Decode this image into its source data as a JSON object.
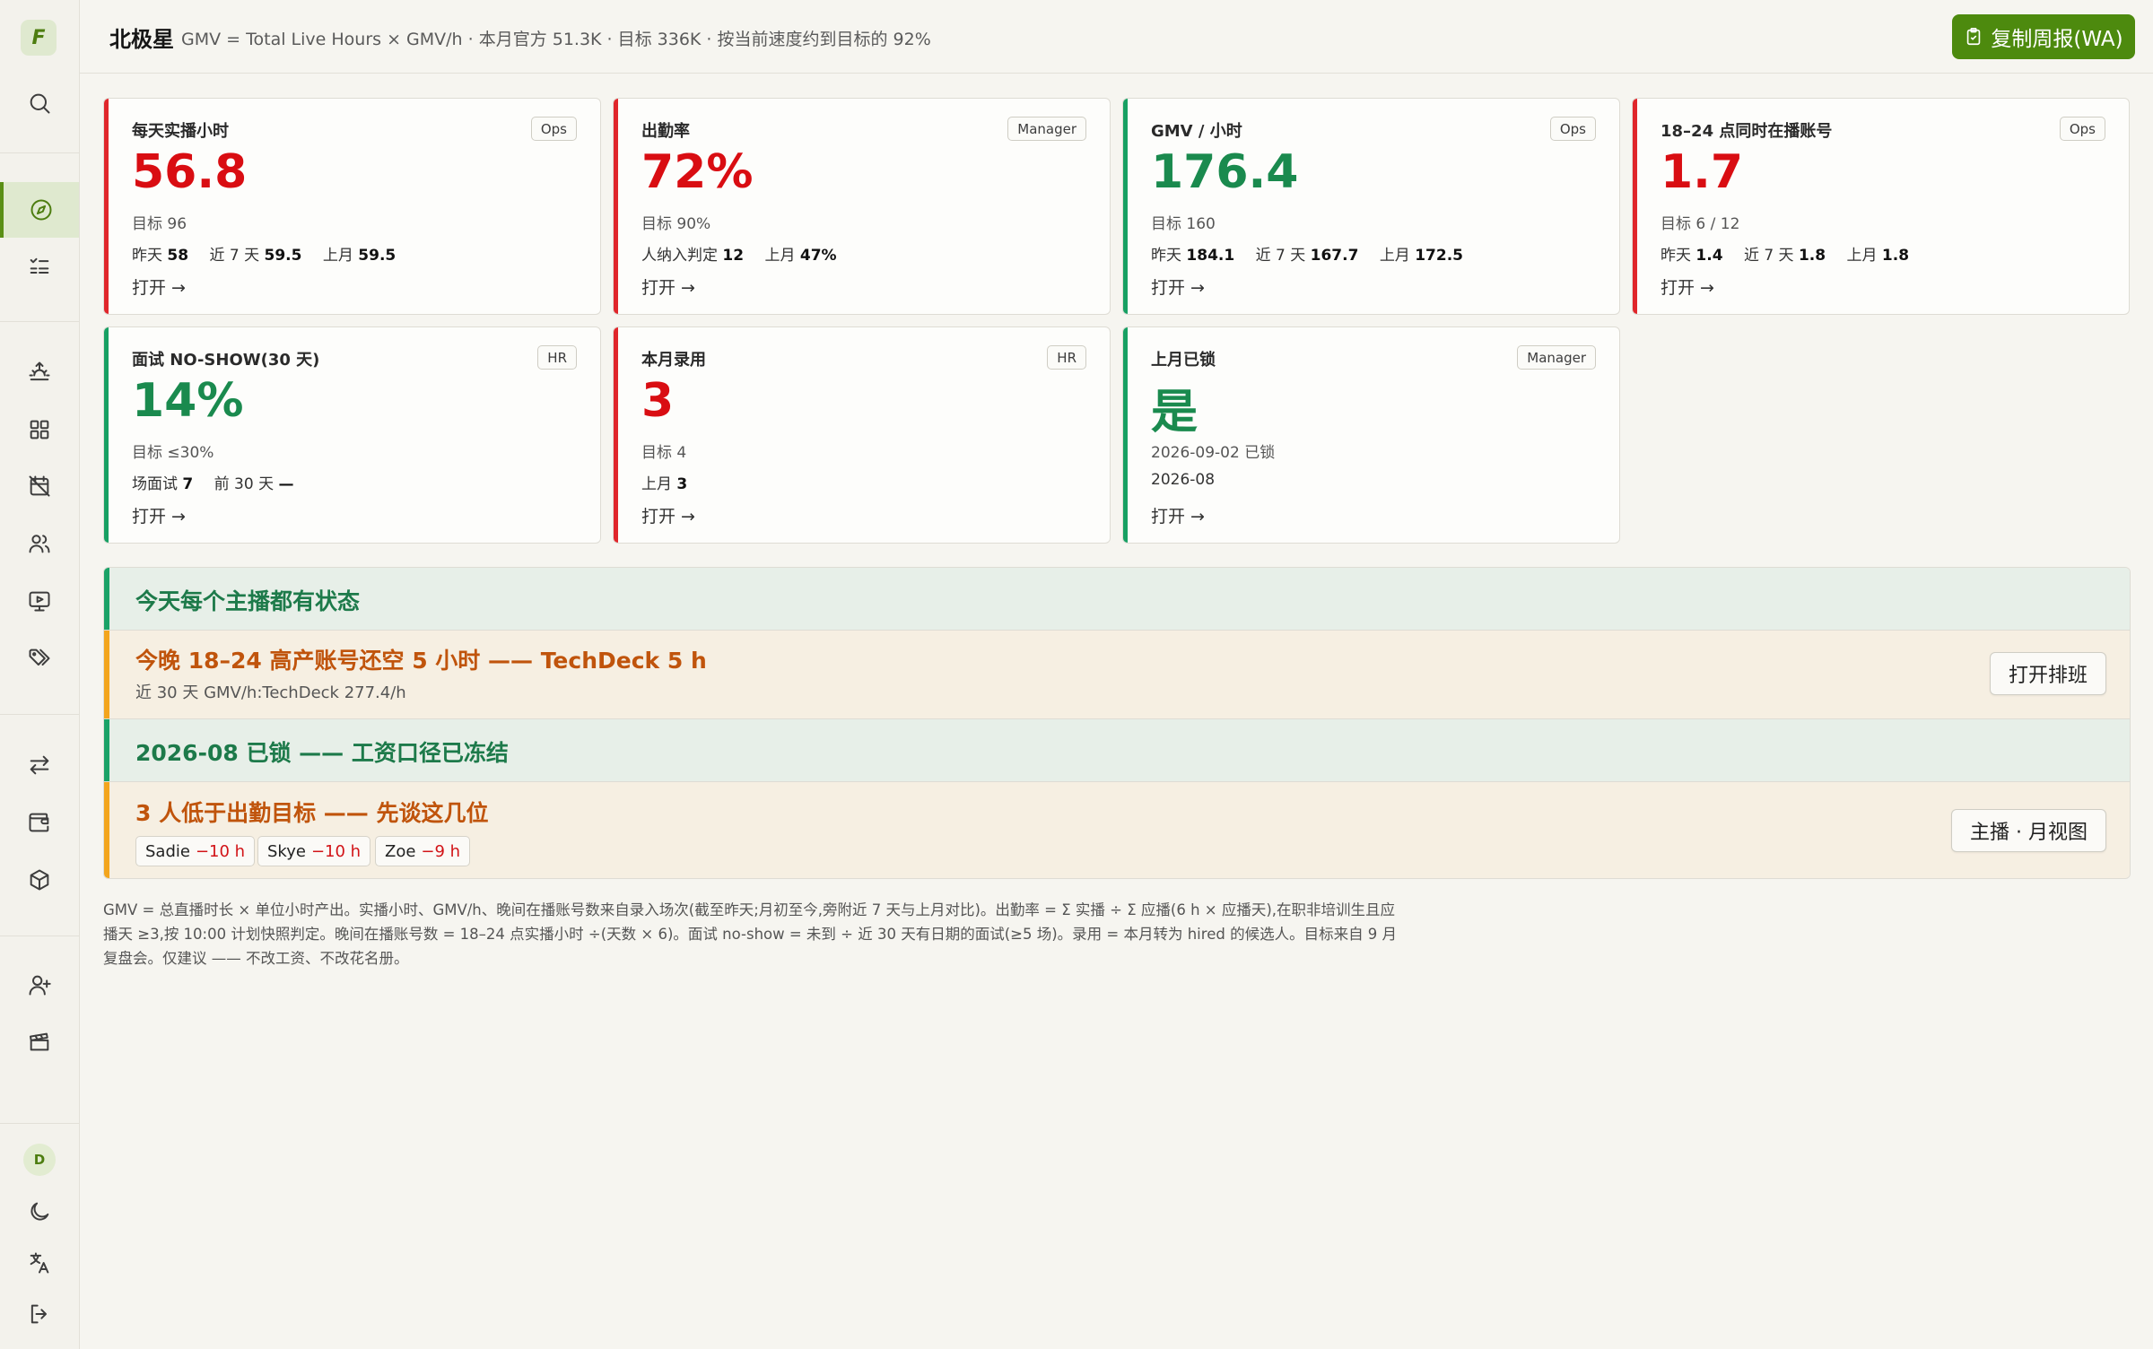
{
  "sidebar": {
    "logo": "F",
    "avatar_initial": "D"
  },
  "header": {
    "title": "北极星",
    "subtitle": "GMV = Total Live Hours × GMV/h · 本月官方 51.3K · 目标 336K · 按当前速度约到目标的 92%",
    "copy_button": "复制周报(WA)"
  },
  "cards": [
    {
      "label": "每天实播小时",
      "tag": "Ops",
      "value": "56.8",
      "target": "目标 96",
      "stats": [
        {
          "k": "昨天",
          "v": "58"
        },
        {
          "k": "近 7 天",
          "v": "59.5"
        },
        {
          "k": "上月",
          "v": "59.5"
        }
      ],
      "open": "打开 →",
      "accent": "#e0262b",
      "value_color": "#d90d12"
    },
    {
      "label": "出勤率",
      "tag": "Manager",
      "value": "72%",
      "target": "目标 90%",
      "stats": [
        {
          "k": "人纳入判定",
          "v": "12"
        },
        {
          "k": "上月",
          "v": "47%"
        }
      ],
      "open": "打开 →",
      "accent": "#e0262b",
      "value_color": "#d90d12"
    },
    {
      "label": "GMV / 小时",
      "tag": "Ops",
      "value": "176.4",
      "target": "目标 160",
      "stats": [
        {
          "k": "昨天",
          "v": "184.1"
        },
        {
          "k": "近 7 天",
          "v": "167.7"
        },
        {
          "k": "上月",
          "v": "172.5"
        }
      ],
      "open": "打开 →",
      "accent": "#17a063",
      "value_color": "#1a8a4e"
    },
    {
      "label": "18–24 点同时在播账号",
      "tag": "Ops",
      "value": "1.7",
      "target": "目标 6 / 12",
      "stats": [
        {
          "k": "昨天",
          "v": "1.4"
        },
        {
          "k": "近 7 天",
          "v": "1.8"
        },
        {
          "k": "上月",
          "v": "1.8"
        }
      ],
      "open": "打开 →",
      "accent": "#e0262b",
      "value_color": "#d90d12"
    },
    {
      "label": "面试 NO-SHOW(30 天)",
      "tag": "HR",
      "value": "14%",
      "target": "目标 ≤30%",
      "stats": [
        {
          "k": "场面试",
          "v": "7"
        },
        {
          "k": "前 30 天",
          "v": "—"
        }
      ],
      "open": "打开 →",
      "accent": "#17a063",
      "value_color": "#1a8a4e"
    },
    {
      "label": "本月录用",
      "tag": "HR",
      "value": "3",
      "target": "目标 4",
      "stats": [
        {
          "k": "上月",
          "v": "3"
        }
      ],
      "open": "打开 →",
      "accent": "#e0262b",
      "value_color": "#d90d12"
    },
    {
      "label": "上月已锁",
      "tag": "Manager",
      "value": "是",
      "target": "2026-09-02 已锁",
      "stats": [
        {
          "k": "2026-08",
          "v": ""
        }
      ],
      "open": "打开 →",
      "accent": "#17a063",
      "value_color": "#1a8a4e"
    }
  ],
  "status": {
    "row1_title": "今天每个主播都有状态",
    "row2_title": "今晚 18–24 高产账号还空 5 小时 —— TechDeck 5 h",
    "row2_sub": "近 30 天 GMV/h:TechDeck 277.4/h",
    "row2_button": "打开排班",
    "row3_title": "2026-08 已锁 —— 工资口径已冻结",
    "row4_title": "3 人低于出勤目标 —— 先谈这几位",
    "row4_button": "主播 · 月视图",
    "chips": [
      {
        "name": "Sadie",
        "delta": "−10 h"
      },
      {
        "name": "Skye",
        "delta": "−10 h"
      },
      {
        "name": "Zoe",
        "delta": "−9 h"
      }
    ]
  },
  "footnote": "GMV = 总直播时长 × 单位小时产出。实播小时、GMV/h、晚间在播账号数来自录入场次(截至昨天;月初至今,旁附近 7 天与上月对比)。出勤率 = Σ 实播 ÷ Σ 应播(6 h × 应播天),在职非培训生且应播天 ≥3,按 10:00 计划快照判定。晚间在播账号数 = 18–24 点实播小时 ÷(天数 × 6)。面试 no-show = 未到 ÷ 近 30 天有日期的面试(≥5 场)。录用 = 本月转为 hired 的候选人。目标来自 9 月复盘会。仅建议 —— 不改工资、不改花名册。"
}
